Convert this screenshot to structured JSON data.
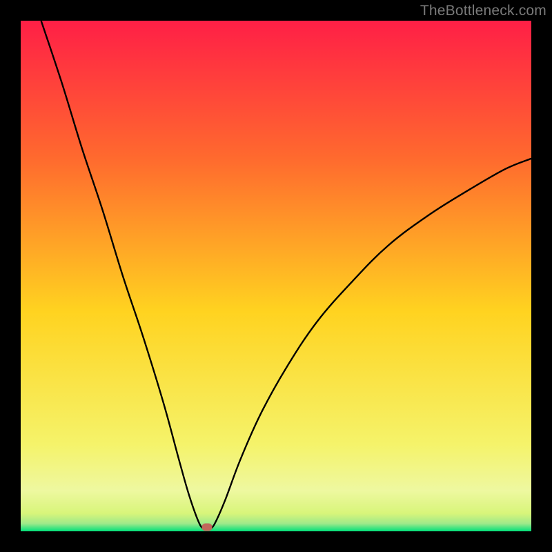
{
  "watermark": "TheBottleneck.com",
  "colors": {
    "top": "#ff1f46",
    "mid_upper": "#ff6a2e",
    "mid": "#ffd320",
    "mid_lower": "#f5f36a",
    "near_bottom": "#d8f57a",
    "bottom": "#00e07a",
    "curve": "#000000",
    "marker": "#c1675b",
    "frame": "#000000"
  },
  "chart_data": {
    "type": "line",
    "title": "",
    "xlabel": "",
    "ylabel": "",
    "x_range": [
      0,
      100
    ],
    "y_range": [
      0,
      100
    ],
    "min_point": {
      "x": 36,
      "y": 0
    },
    "curve_model": "abs-bottleneck-v",
    "series": [
      {
        "name": "bottleneck-curve",
        "points": [
          {
            "x": 4,
            "y": 100
          },
          {
            "x": 8,
            "y": 88
          },
          {
            "x": 12,
            "y": 75
          },
          {
            "x": 16,
            "y": 63
          },
          {
            "x": 20,
            "y": 50
          },
          {
            "x": 24,
            "y": 38
          },
          {
            "x": 28,
            "y": 25
          },
          {
            "x": 31,
            "y": 14
          },
          {
            "x": 33,
            "y": 7
          },
          {
            "x": 35,
            "y": 1.5
          },
          {
            "x": 36,
            "y": 0.5
          },
          {
            "x": 37,
            "y": 0.5
          },
          {
            "x": 38,
            "y": 1.5
          },
          {
            "x": 40,
            "y": 6
          },
          {
            "x": 43,
            "y": 14
          },
          {
            "x": 47,
            "y": 23
          },
          {
            "x": 52,
            "y": 32
          },
          {
            "x": 58,
            "y": 41
          },
          {
            "x": 65,
            "y": 49
          },
          {
            "x": 72,
            "y": 56
          },
          {
            "x": 80,
            "y": 62
          },
          {
            "x": 88,
            "y": 67
          },
          {
            "x": 95,
            "y": 71
          },
          {
            "x": 100,
            "y": 73
          }
        ]
      }
    ],
    "marker": {
      "x": 36.5,
      "y": 0.8
    }
  }
}
